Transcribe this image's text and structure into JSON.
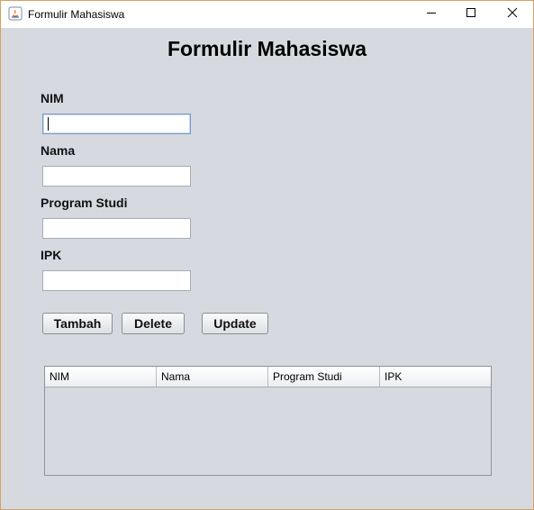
{
  "window": {
    "title": "Formulir Mahasiswa",
    "icons": [
      "java-app-icon",
      "minimize-icon",
      "maximize-icon",
      "close-icon"
    ]
  },
  "form": {
    "heading": "Formulir Mahasiswa",
    "fields": [
      {
        "label": "NIM",
        "value": ""
      },
      {
        "label": "Nama",
        "value": ""
      },
      {
        "label": "Program Studi",
        "value": ""
      },
      {
        "label": "IPK",
        "value": ""
      }
    ],
    "buttons": {
      "tambah": "Tambah",
      "delete": "Delete",
      "update": "Update"
    }
  },
  "table": {
    "columns": [
      "NIM",
      "Nama",
      "Program Studi",
      "IPK"
    ],
    "rows": []
  },
  "colors": {
    "background": "#d6d9e0",
    "window_border": "#d9a05b",
    "focus_border": "#7a9cc6"
  }
}
